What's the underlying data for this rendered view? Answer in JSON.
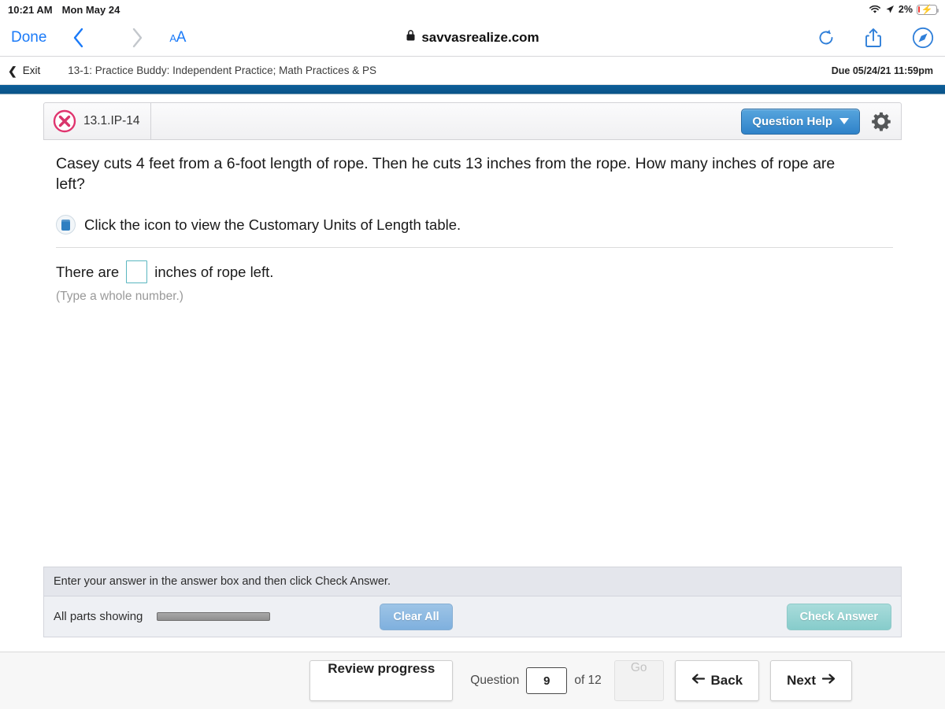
{
  "status_bar": {
    "time": "10:21 AM",
    "date": "Mon May 24",
    "battery_percent": "2%",
    "wifi_icon": "wifi-icon",
    "location_icon": "location-arrow-icon",
    "battery_icon": "battery-charging-icon"
  },
  "browser": {
    "done_label": "Done",
    "back_icon": "chevron-left-icon",
    "forward_icon": "chevron-right-icon",
    "text_size_small": "A",
    "text_size_large": "A",
    "lock_icon": "lock-icon",
    "url": "savvasrealize.com",
    "reload_icon": "reload-icon",
    "share_icon": "share-icon",
    "compass_icon": "compass-icon",
    "accent_color": "#1a7af8"
  },
  "course_bar": {
    "exit_label": "Exit",
    "exit_icon": "chevron-left-icon",
    "title": "13-1: Practice Buddy: Independent Practice; Math Practices & PS",
    "due": "Due 05/24/21 11:59pm"
  },
  "question": {
    "id": "13.1.IP-14",
    "status_icon": "incorrect-x-icon",
    "status_color": "#d8356b",
    "help_label": "Question Help",
    "help_caret_icon": "caret-down-icon",
    "settings_icon": "gear-icon",
    "text": "Casey cuts 4 feet from a 6-foot length of rope. Then he cuts 13 inches from the rope. How many inches of rope are left?",
    "resource_icon": "table-resource-icon",
    "resource_text": "Click the icon to view the Customary Units of Length table.",
    "answer_prefix": "There are",
    "answer_value": "",
    "answer_suffix": "inches of rope left.",
    "hint": "(Type a whole number.)"
  },
  "action_bar": {
    "instruction": "Enter your answer in the answer box and then click Check Answer.",
    "parts_status": "All parts showing",
    "progress_percent": 100,
    "clear_all_label": "Clear All",
    "check_answer_label": "Check Answer"
  },
  "footer": {
    "review_label": "Review progress",
    "question_label": "Question",
    "current_question": "9",
    "of_label": "of 12",
    "go_label": "Go",
    "back_label": "Back",
    "back_icon": "arrow-left-icon",
    "next_label": "Next",
    "next_icon": "arrow-right-icon"
  }
}
